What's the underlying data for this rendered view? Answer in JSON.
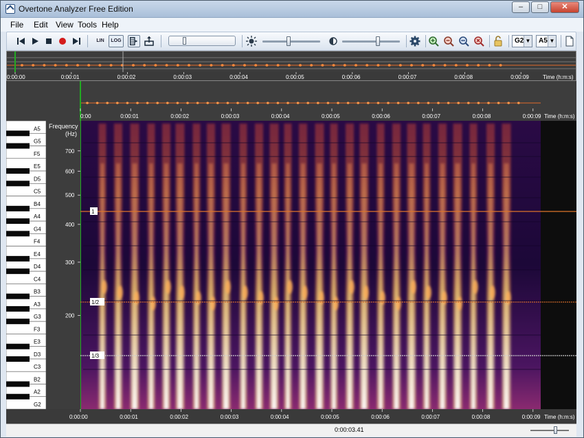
{
  "window": {
    "title": "Overtone Analyzer Free Edition",
    "minimize_label": "–",
    "maximize_label": "□",
    "close_label": "✕"
  },
  "menu": [
    "File",
    "Edit",
    "View",
    "Tools",
    "Help"
  ],
  "toolbar": {
    "scale_lin_label": "LIN",
    "scale_log_label": "LOG",
    "scale_mode": "LOG",
    "gain_level": 0.2,
    "brightness_level": 0.45,
    "contrast_level": 0.62,
    "range_low_note": "G2",
    "range_high_note": "A5",
    "icons": [
      "skip-back-icon",
      "play-icon",
      "stop-icon",
      "record-icon",
      "skip-forward-icon",
      "spectrum-view-icon",
      "export-icon",
      "brightness-icon",
      "contrast-icon",
      "settings-gear-icon",
      "zoom-in-icon",
      "zoom-out-icon",
      "zoom-fit-icon",
      "zoom-reset-icon",
      "lock-icon",
      "new-document-icon"
    ]
  },
  "timeline": {
    "ticks": [
      "0:00:00",
      "0:00:01",
      "0:00:02",
      "0:00:03",
      "0:00:04",
      "0:00:05",
      "0:00:06",
      "0:00:07",
      "0:00:08",
      "0:00:09"
    ],
    "axis_label": "Time (h:m:s)",
    "overview_first_tick": "0:00:00",
    "mid_first_tick": "0:00"
  },
  "frequency_axis": {
    "label_line1": "Frequency",
    "label_line2": "(Hz)",
    "ticks": [
      "700",
      "600",
      "500",
      "400",
      "300",
      "200"
    ]
  },
  "piano": {
    "notes": [
      "A5",
      "G5",
      "F5",
      "E5",
      "D5",
      "C5",
      "B4",
      "A4",
      "G4",
      "F4",
      "E4",
      "D4",
      "C4",
      "B3",
      "A3",
      "G3",
      "F3",
      "E3",
      "D3",
      "C3",
      "B2",
      "A2",
      "G2"
    ]
  },
  "harmonic_markers": [
    {
      "label": "1",
      "color": "#e0762a"
    },
    {
      "label": "1/2",
      "color": "#d06a2a"
    },
    {
      "label": "1/3",
      "color": "#cfcfcf"
    }
  ],
  "status": {
    "position_time": "0:00:03.41",
    "zoom_level": 0.6
  },
  "colors": {
    "spectrogram_bright": "#fff2b0",
    "spectrogram_mid": "#d04a2a",
    "spectrogram_dark": "#1a0630",
    "waveform": "#e46a2a",
    "playhead": "#22aa22"
  }
}
